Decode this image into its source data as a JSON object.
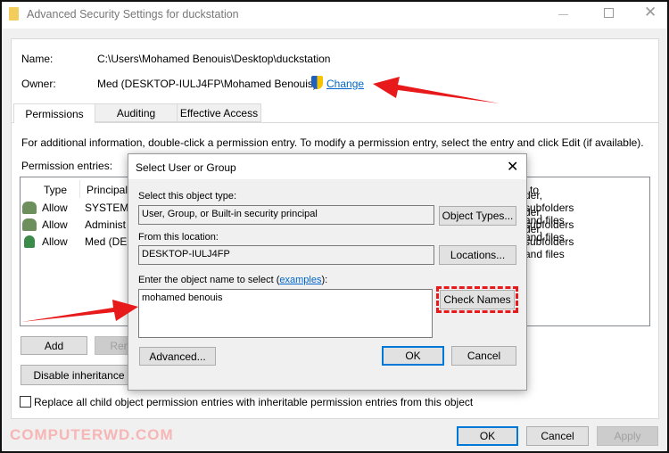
{
  "window": {
    "title": "Advanced Security Settings for duckstation"
  },
  "info": {
    "name_label": "Name:",
    "name_value": "C:\\Users\\Mohamed Benouis\\Desktop\\duckstation",
    "owner_label": "Owner:",
    "owner_value": "Med (DESKTOP-IULJ4FP\\Mohamed Benouis)",
    "change_link": "Change"
  },
  "tabs": [
    {
      "label": "Permissions",
      "selected": true
    },
    {
      "label": "Auditing"
    },
    {
      "label": "Effective Access"
    }
  ],
  "description": "For additional information, double-click a permission entry. To modify a permission entry, select the entry and click Edit (if available).",
  "entries": {
    "label": "Permission entries:",
    "headers": {
      "type": "Type",
      "principal": "Principal",
      "applies": "to"
    },
    "rows": [
      {
        "type": "Allow",
        "principal": "SYSTEM",
        "applies": "der, subfolders and files"
      },
      {
        "type": "Allow",
        "principal": "Administ",
        "applies": "der, subfolders and files"
      },
      {
        "type": "Allow",
        "principal": "Med (DE",
        "applies": "der, subfolders and files"
      }
    ]
  },
  "buttons": {
    "add": "Add",
    "remove": "Rem",
    "disable_inheritance": "Disable inheritance",
    "ok": "OK",
    "cancel": "Cancel",
    "apply": "Apply"
  },
  "replace_checkbox": {
    "label": "Replace all child object permission entries with inheritable permission entries from this object",
    "checked": false
  },
  "dialog": {
    "title": "Select User or Group",
    "object_type_label": "Select this object type:",
    "object_type_value": "User, Group, or Built-in security principal",
    "object_types_button": "Object Types...",
    "location_label": "From this location:",
    "location_value": "DESKTOP-IULJ4FP",
    "locations_button": "Locations...",
    "name_label_pre": "Enter the object name to select (",
    "examples_link": "examples",
    "name_label_post": "):",
    "name_value": "mohamed benouis",
    "check_names_button": "Check Names",
    "advanced_button": "Advanced...",
    "ok_button": "OK",
    "cancel_button": "Cancel"
  },
  "watermark": "COMPUTERWD.COM",
  "colors": {
    "link": "#0066cc",
    "accent": "#0078d7",
    "annotation": "#e8191a"
  }
}
